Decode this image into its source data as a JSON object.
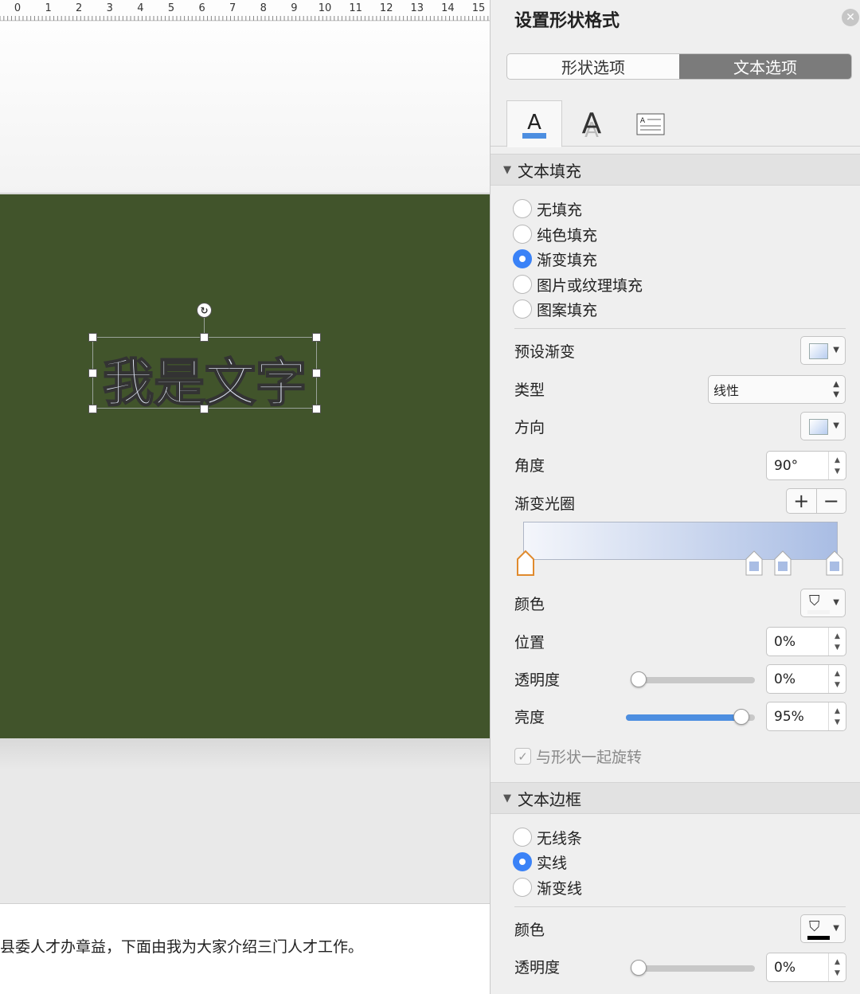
{
  "ruler": {
    "numbers": [
      "0",
      "1",
      "2",
      "3",
      "4",
      "5",
      "6",
      "7",
      "8",
      "9",
      "10",
      "11",
      "12",
      "13",
      "14",
      "15"
    ]
  },
  "slide": {
    "text": "我是文字",
    "background": "#41542b"
  },
  "document": {
    "body_text": "县委人才办章益，下面由我为大家介绍三门人才工作。"
  },
  "pane": {
    "title": "设置形状格式",
    "tabs": [
      {
        "label": "形状选项",
        "active": false
      },
      {
        "label": "文本选项",
        "active": true
      }
    ],
    "icon_tabs": [
      "text-fill-outline-icon",
      "text-effects-icon",
      "text-box-layout-icon"
    ],
    "fill_section": {
      "title": "文本填充",
      "options": [
        {
          "label": "无填充",
          "selected": false
        },
        {
          "label": "纯色填充",
          "selected": false
        },
        {
          "label": "渐变填充",
          "selected": true
        },
        {
          "label": "图片或纹理填充",
          "selected": false
        },
        {
          "label": "图案填充",
          "selected": false
        }
      ],
      "preset_label": "预设渐变",
      "type_label": "类型",
      "type_value": "线性",
      "direction_label": "方向",
      "angle_label": "角度",
      "angle_value": "90°",
      "stops_label": "渐变光圈",
      "color_label": "颜色",
      "position_label": "位置",
      "position_value": "0%",
      "transparency_label": "透明度",
      "transparency_value": "0%",
      "transparency_level": 0,
      "brightness_label": "亮度",
      "brightness_value": "95%",
      "brightness_level": 0.95,
      "rotate_label": "与形状一起旋转",
      "rotate_checked": true
    },
    "border_section": {
      "title": "文本边框",
      "options": [
        {
          "label": "无线条",
          "selected": false
        },
        {
          "label": "实线",
          "selected": true
        },
        {
          "label": "渐变线",
          "selected": false
        }
      ],
      "color_label": "颜色",
      "color_value": "#000000",
      "transparency_label": "透明度",
      "transparency_value": "0%",
      "transparency_level": 0
    }
  },
  "colors": {
    "accent": "#3a82f7",
    "gradient_start": "#f4f6fb",
    "gradient_end": "#a9bde4"
  }
}
